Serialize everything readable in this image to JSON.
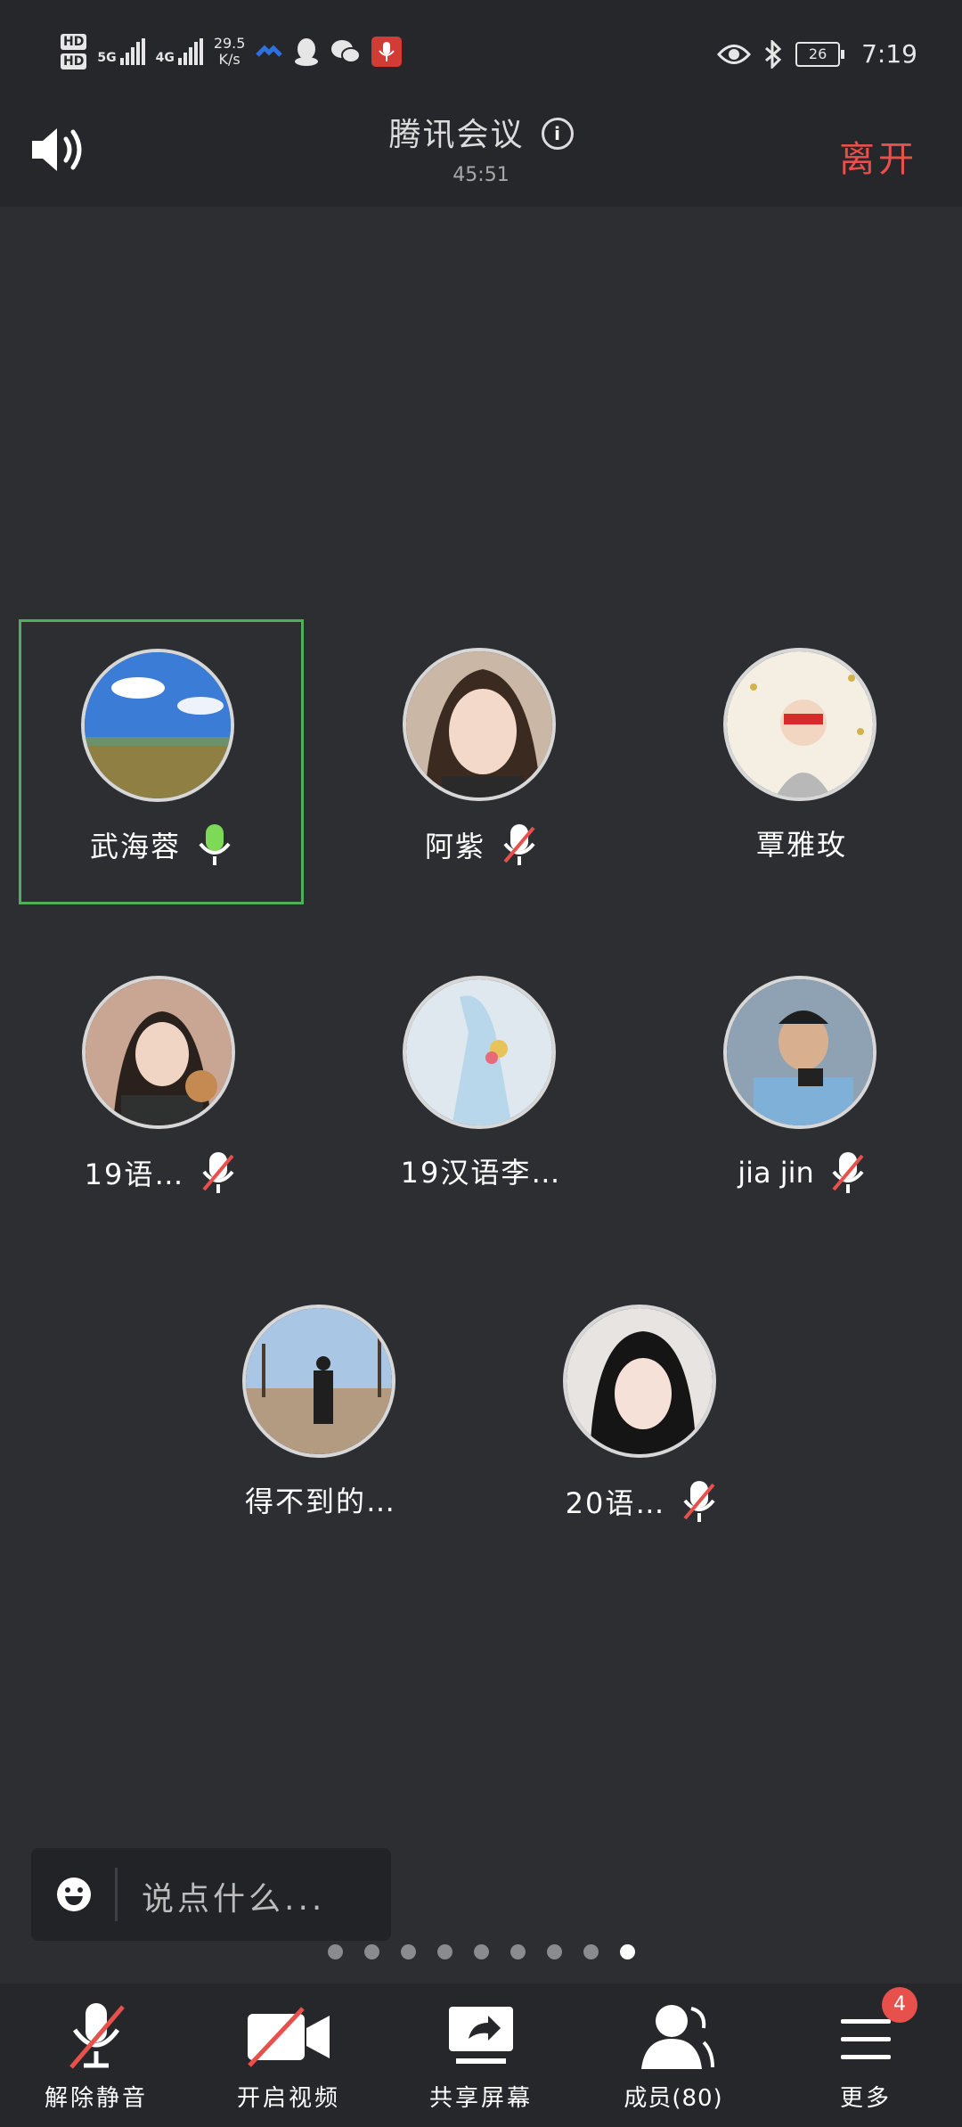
{
  "status_bar": {
    "net_speed": "29.5",
    "net_unit": "K/s",
    "sig1_label": "5G",
    "sig2_label": "4G",
    "hd1": "HD",
    "hd2": "HD",
    "battery": "26",
    "time": "7:19",
    "icons": [
      "eye-icon",
      "bluetooth-icon",
      "qq-icon",
      "wechat-icon",
      "mic-record-icon"
    ]
  },
  "header": {
    "title": "腾讯会议",
    "timer": "45:51",
    "leave_label": "离开"
  },
  "participants": [
    {
      "name": "武海蓉",
      "mic": "on",
      "active": true
    },
    {
      "name": "阿紫",
      "mic": "muted"
    },
    {
      "name": "覃雅玫",
      "mic": "none"
    },
    {
      "name": "19语…",
      "mic": "muted"
    },
    {
      "name": "19汉语李…",
      "mic": "none"
    },
    {
      "name": "jia jin",
      "mic": "muted"
    },
    {
      "name": "得不到的…",
      "mic": "none"
    },
    {
      "name": "20语…",
      "mic": "muted"
    }
  ],
  "chat": {
    "placeholder": "说点什么..."
  },
  "pager": {
    "total": 9,
    "current": 9
  },
  "toolbar": {
    "unmute_label": "解除静音",
    "video_label": "开启视频",
    "share_label": "共享屏幕",
    "members_label": "成员(80)",
    "more_label": "更多",
    "more_badge": "4"
  },
  "colors": {
    "accent_red": "#e8504b",
    "active_green": "#4fb05a",
    "mic_green": "#7ed957"
  }
}
